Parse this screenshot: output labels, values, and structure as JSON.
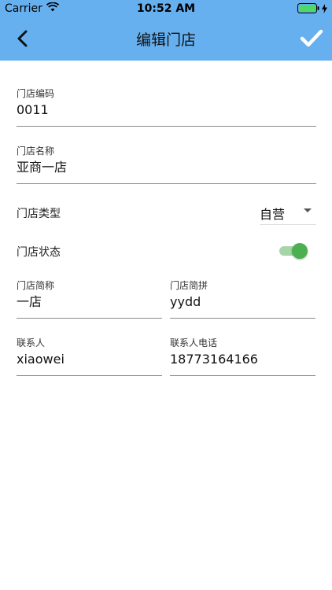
{
  "status_bar": {
    "carrier": "Carrier",
    "time": "10:52 AM"
  },
  "nav": {
    "title": "编辑门店",
    "back_icon": "chevron-left-icon",
    "confirm_icon": "check-icon"
  },
  "form": {
    "store_code": {
      "label": "门店编码",
      "value": "0011"
    },
    "store_name": {
      "label": "门店名称",
      "value": "亚商一店"
    },
    "store_type": {
      "label": "门店类型",
      "value": "自营"
    },
    "store_status": {
      "label": "门店状态",
      "enabled": true
    },
    "short_name": {
      "label": "门店简称",
      "value": "一店"
    },
    "short_pinyin": {
      "label": "门店简拼",
      "value": "yydd"
    },
    "contact": {
      "label": "联系人",
      "value": "xiaowei"
    },
    "contact_phone": {
      "label": "联系人电话",
      "value": "18773164166"
    }
  },
  "colors": {
    "header": "#66b0f0",
    "toggle_on": "#4caf50",
    "battery": "#4cd964"
  }
}
